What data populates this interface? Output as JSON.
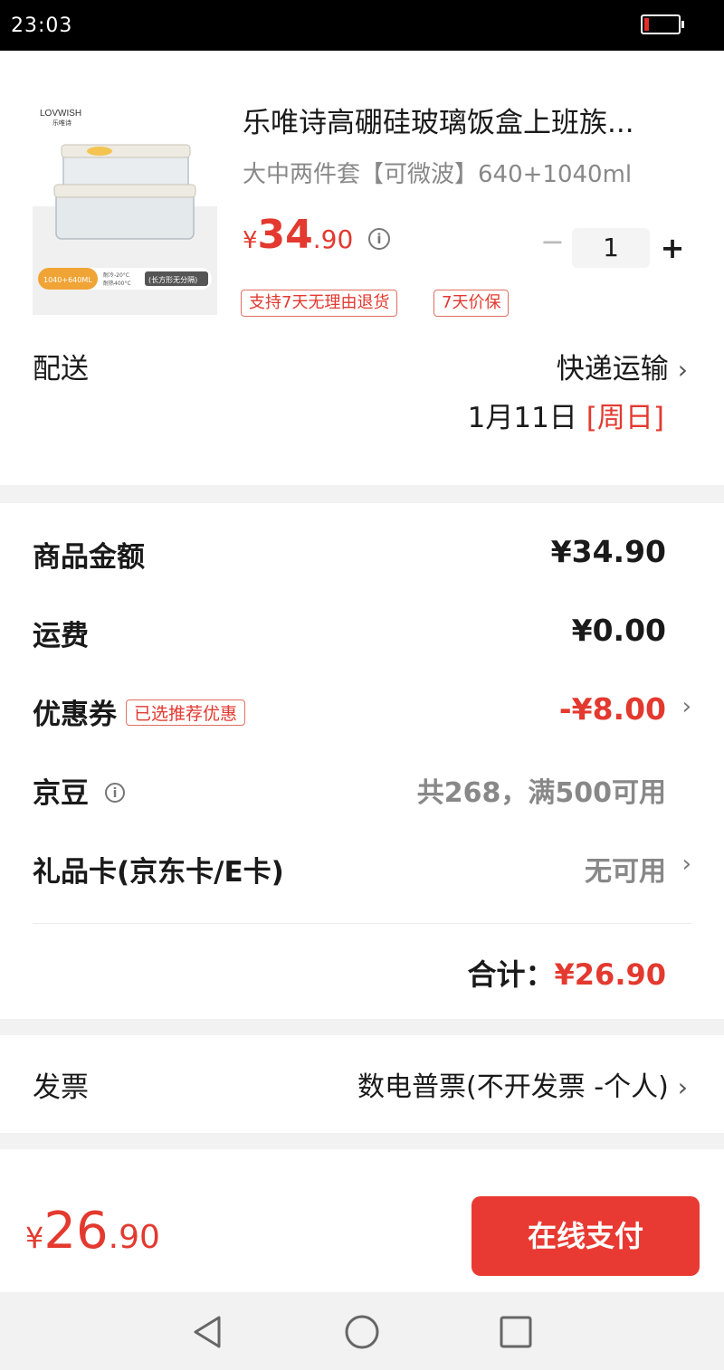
{
  "status_bar": {
    "time": "23:03"
  },
  "product": {
    "brand_logo": "LOVWISH",
    "brand_logo_cn": "乐唯诗",
    "image_badge": "1040+640ML",
    "image_temp1": "耐冷-20°C",
    "image_temp2": "耐热400°C",
    "image_shape": "(长方形无分隔)",
    "title": "乐唯诗高硼硅玻璃饭盒上班族...",
    "spec": "大中两件套【可微波】640+1040ml",
    "price_currency": "¥",
    "price_int": "34",
    "price_dec": ".90",
    "quantity": "1",
    "qty_minus": "−",
    "qty_plus": "+",
    "tags": [
      "支持7天无理由退货",
      "7天价保"
    ]
  },
  "shipping": {
    "label": "配送",
    "method": "快递运输",
    "date": "1月11日",
    "weekday": "[周日]"
  },
  "summary": {
    "goods_label": "商品金额",
    "goods_value": "¥34.90",
    "freight_label": "运费",
    "freight_value": "¥0.00",
    "coupon_label": "优惠券",
    "coupon_badge": "已选推荐优惠",
    "coupon_value": "-¥8.00",
    "jingdou_label": "京豆",
    "jingdou_value": "共268，满500可用",
    "giftcard_label": "礼品卡(京东卡/E卡)",
    "giftcard_value": "无可用",
    "total_label": "合计：",
    "total_value": "¥26.90"
  },
  "invoice": {
    "label": "发票",
    "value": "数电普票(不开发票 -个人)"
  },
  "bottom_bar": {
    "price_currency": "¥",
    "price_int": "26",
    "price_dec": ".90",
    "pay_button": "在线支付"
  },
  "colors": {
    "accent_red": "#e3392f",
    "pay_button": "#e83a33"
  },
  "icons": {
    "info": "info-circle-icon",
    "chevron": "chevron-right-icon",
    "nav_back": "back-triangle-icon",
    "nav_home": "home-circle-icon",
    "nav_recents": "recents-square-icon"
  }
}
